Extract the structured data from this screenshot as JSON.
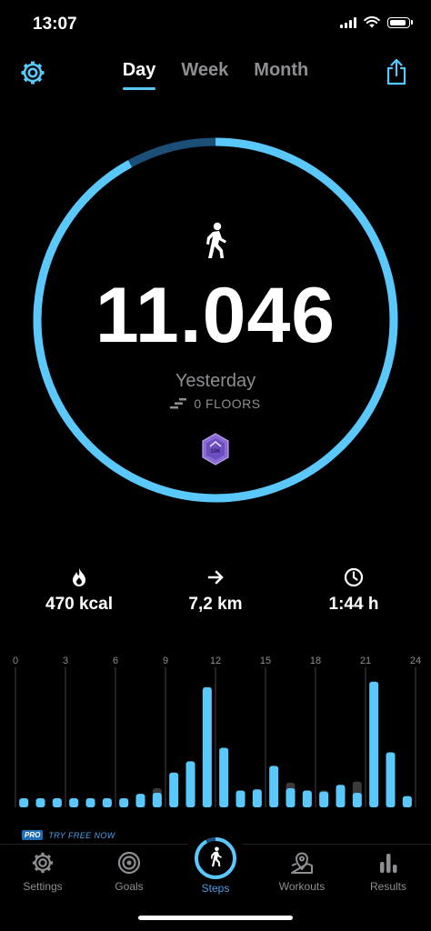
{
  "status": {
    "time": "13:07"
  },
  "header": {
    "tabs": [
      {
        "label": "Day",
        "active": true
      },
      {
        "label": "Week",
        "active": false
      },
      {
        "label": "Month",
        "active": false
      }
    ],
    "settings_icon": "gear-icon",
    "share_icon": "share-icon"
  },
  "summary": {
    "steps": "11.046",
    "day": "Yesterday",
    "floors": "0 FLOORS",
    "badge": "10K",
    "goal_progress": 0.92,
    "accent": "#5ac8fa"
  },
  "stats": [
    {
      "icon": "flame-icon",
      "value": "470 kcal"
    },
    {
      "icon": "arrow-right-icon",
      "value": "7,2 km"
    },
    {
      "icon": "clock-icon",
      "value": "1:44 h"
    }
  ],
  "chart_data": {
    "type": "bar",
    "x_ticks": [
      "0",
      "3",
      "6",
      "9",
      "12",
      "15",
      "18",
      "21",
      "24"
    ],
    "series": [
      {
        "values": [
          80,
          80,
          80,
          80,
          80,
          80,
          80,
          120,
          130,
          310,
          410,
          1070,
          530,
          150,
          160,
          370,
          170,
          150,
          140,
          200,
          130,
          1120,
          490,
          100
        ]
      },
      {
        "values": [
          60,
          60,
          60,
          60,
          60,
          60,
          60,
          100,
          170,
          120,
          80,
          40,
          40,
          40,
          40,
          60,
          220,
          150,
          150,
          80,
          230,
          60,
          80,
          100
        ]
      }
    ],
    "colors": [
      "#5ac8fa",
      "#3a3a3c"
    ],
    "ylim": [
      0,
      1150
    ]
  },
  "promo": {
    "pill": "PRO",
    "text": "TRY FREE NOW"
  },
  "tabbar": [
    {
      "label": "Settings",
      "icon": "gear-icon",
      "active": false
    },
    {
      "label": "Goals",
      "icon": "target-icon",
      "active": false
    },
    {
      "label": "Steps",
      "icon": "walker-icon",
      "active": true
    },
    {
      "label": "Workouts",
      "icon": "map-pin-icon",
      "active": false
    },
    {
      "label": "Results",
      "icon": "bar-chart-icon",
      "active": false
    }
  ]
}
